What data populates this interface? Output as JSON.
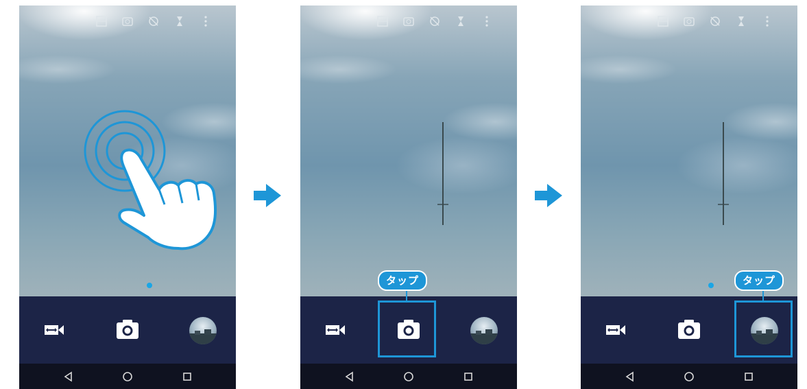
{
  "colors": {
    "accent": "#1e96d7",
    "control_bar": "#1c2447",
    "nav_bar": "#0f1220"
  },
  "screens": [
    {
      "step": 1,
      "top_icons": [
        "hdr-icon",
        "timer-mode-icon",
        "flash-off-icon",
        "settings-icon",
        "more-icon"
      ],
      "controls": [
        "video-icon",
        "shutter-icon",
        "gallery-thumbnail"
      ],
      "nav": [
        "back-icon",
        "home-icon",
        "recents-icon"
      ],
      "gesture": "tap-gesture-hand-icon"
    },
    {
      "step": 2,
      "top_icons": [
        "hdr-icon",
        "timer-mode-icon",
        "flash-off-icon",
        "settings-icon",
        "more-icon"
      ],
      "controls": [
        "video-icon",
        "shutter-icon",
        "gallery-thumbnail"
      ],
      "nav": [
        "back-icon",
        "home-icon",
        "recents-icon"
      ],
      "callout": {
        "label": "タップ",
        "target": "shutter-icon"
      }
    },
    {
      "step": 3,
      "top_icons": [
        "hdr-icon",
        "timer-mode-icon",
        "flash-off-icon",
        "settings-icon",
        "more-icon"
      ],
      "controls": [
        "video-icon",
        "shutter-icon",
        "gallery-thumbnail"
      ],
      "nav": [
        "back-icon",
        "home-icon",
        "recents-icon"
      ],
      "callout": {
        "label": "タップ",
        "target": "gallery-thumbnail"
      }
    }
  ],
  "step_arrows": [
    "arrow-right-icon",
    "arrow-right-icon"
  ]
}
